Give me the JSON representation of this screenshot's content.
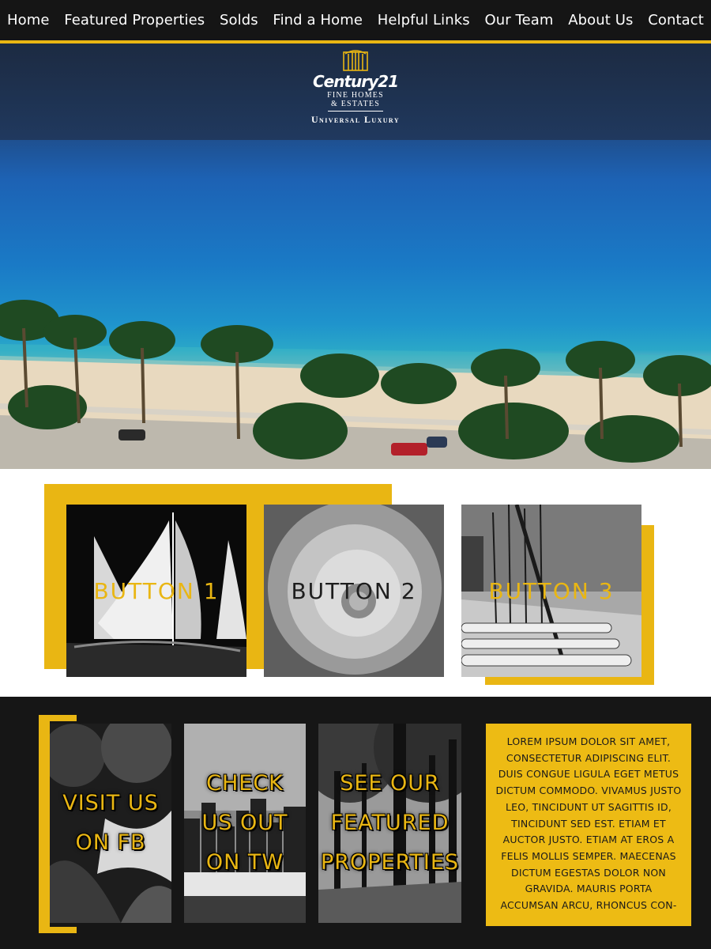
{
  "nav": {
    "items": [
      {
        "label": "Home"
      },
      {
        "label": "Featured Properties"
      },
      {
        "label": "Solds"
      },
      {
        "label": "Find a Home"
      },
      {
        "label": "Helpful Links"
      },
      {
        "label": "Our Team"
      },
      {
        "label": "About Us"
      },
      {
        "label": "Contact"
      }
    ]
  },
  "logo": {
    "brand": "Century21",
    "line1": "FINE HOMES",
    "line2": "& ESTATES",
    "company": "Universal Luxury"
  },
  "buttons": [
    {
      "label": "BUTTON 1"
    },
    {
      "label": "BUTTON 2"
    },
    {
      "label": "BUTTON 3"
    }
  ],
  "social": [
    {
      "line1": "VISIT US",
      "line2": "ON FB"
    },
    {
      "line1": "CHECK",
      "line2": "US OUT",
      "line3": "ON TW"
    },
    {
      "line1": "SEE OUR",
      "line2": "FEATURED",
      "line3": "PROPERTIES"
    }
  ],
  "lorem": {
    "text": "Lorem ipsum dolor sit amet, consectetur adipiscing elit. Duis congue ligula eget metus dictum commodo. Vivamus justo leo, tincidunt ut sagittis id, tincidunt sed est. Etiam et auctor justo. Etiam at eros a felis mollis semper. Maecenas dictum egestas dolor non gravida. Mauris porta accumsan arcu, rhoncus con-"
  },
  "colors": {
    "accent": "#e9b613",
    "nav_bg": "#151515",
    "footer_bg": "#161616"
  }
}
